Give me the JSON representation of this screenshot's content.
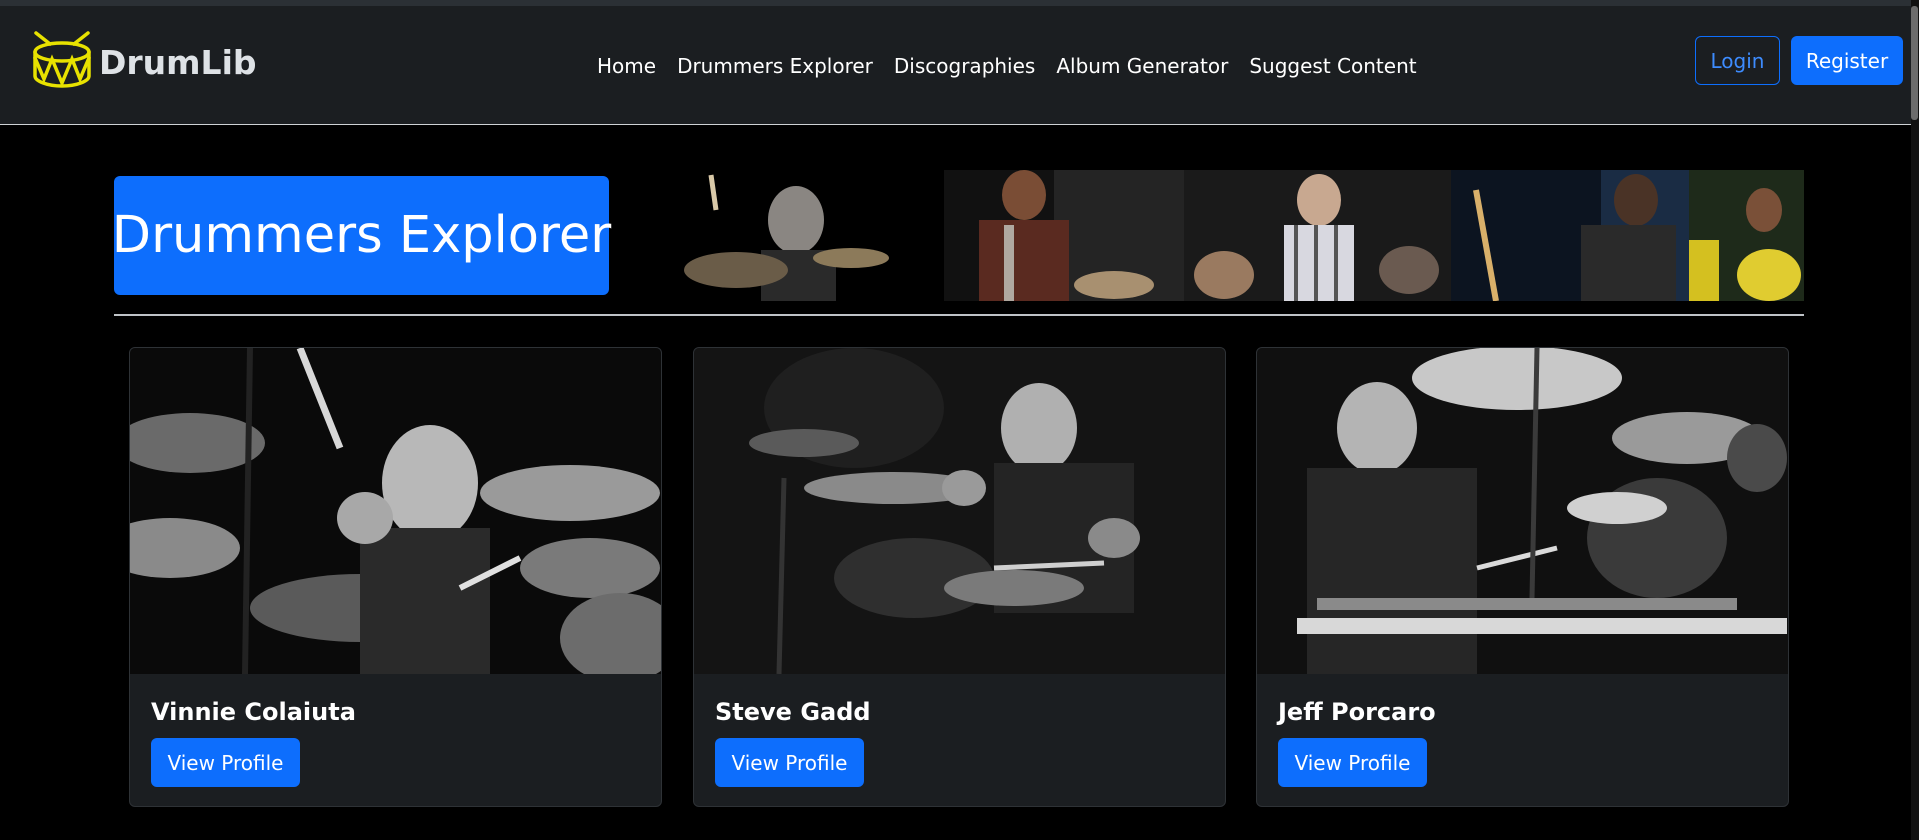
{
  "brand": {
    "name": "DrumLib",
    "logo_icon": "drum-icon",
    "logo_color": "#e8e200"
  },
  "nav": {
    "items": [
      "Home",
      "Drummers Explorer",
      "Discographies",
      "Album Generator",
      "Suggest Content"
    ]
  },
  "auth": {
    "login_label": "Login",
    "register_label": "Register"
  },
  "hero": {
    "title": "Drummers Explorer"
  },
  "colors": {
    "accent": "#0d6efd",
    "navbar_bg": "#1b1e21",
    "card_bg": "#1b1e21",
    "page_bg": "#000000"
  },
  "drummers": [
    {
      "name": "Vinnie Colaiuta",
      "button_label": "View Profile",
      "photo_icon": "drummer-photo-icon"
    },
    {
      "name": "Steve Gadd",
      "button_label": "View Profile",
      "photo_icon": "drummer-photo-icon"
    },
    {
      "name": "Jeff Porcaro",
      "button_label": "View Profile",
      "photo_icon": "drummer-photo-icon"
    }
  ]
}
